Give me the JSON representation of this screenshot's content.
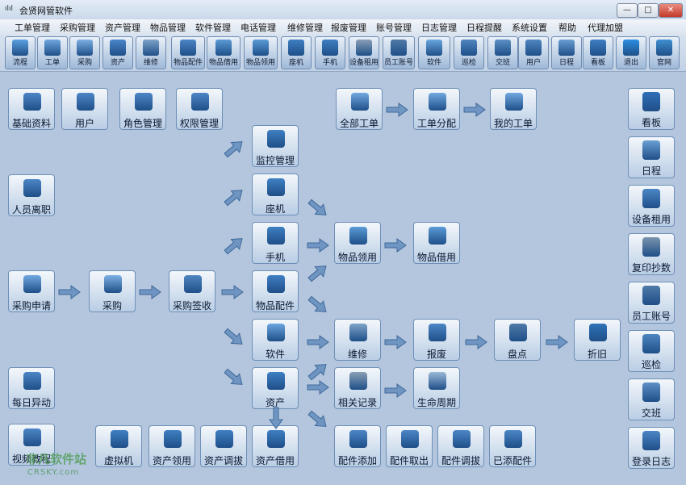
{
  "window": {
    "title": "会贤网管软件",
    "app_icon": "app-logo-icon",
    "controls": [
      "minimize-icon",
      "maximize-icon",
      "close-icon"
    ]
  },
  "menu": [
    "工单管理",
    "采购管理",
    "资产管理",
    "物品管理",
    "软件管理",
    "电话管理",
    "维修管理",
    "报废管理",
    "账号管理",
    "日志管理",
    "日程提醒",
    "系统设置",
    "帮助",
    "代理加盟"
  ],
  "toolbar": [
    {
      "label": "流程",
      "icon": "flow-icon",
      "color": "#5aa0e0"
    },
    {
      "label": "工单",
      "icon": "document-icon",
      "color": "#6fa8df"
    },
    {
      "label": "采购",
      "icon": "cart-icon",
      "color": "#7db0e2"
    },
    {
      "label": "资产",
      "icon": "monitor-icon",
      "color": "#4b86c9"
    },
    {
      "label": "维修",
      "icon": "tools-icon",
      "color": "#7ea3c9"
    },
    {
      "label": "物品配件",
      "icon": "parts-icon",
      "color": "#4c86c6"
    },
    {
      "label": "物品借用",
      "icon": "borrow-icon",
      "color": "#5a9bd6"
    },
    {
      "label": "物品领用",
      "icon": "receive-icon",
      "color": "#5a9bd6"
    },
    {
      "label": "座机",
      "icon": "phone-icon",
      "color": "#3f7fc2"
    },
    {
      "label": "手机",
      "icon": "mobile-icon",
      "color": "#3f7fc2"
    },
    {
      "label": "设备租用",
      "icon": "printer-icon",
      "color": "#8a9fb6"
    },
    {
      "label": "员工账号",
      "icon": "lock-icon",
      "color": "#4f7aa8"
    },
    {
      "label": "软件",
      "icon": "disc-icon",
      "color": "#6aa6df"
    },
    {
      "label": "巡检",
      "icon": "patrol-icon",
      "color": "#4f86c0"
    },
    {
      "label": "交班",
      "icon": "handshake-icon",
      "color": "#5c8fc6"
    },
    {
      "label": "用户",
      "icon": "user-icon",
      "color": "#4f86c0"
    },
    {
      "label": "日程",
      "icon": "calendar-icon",
      "color": "#6a9fd3"
    },
    {
      "label": "看板",
      "icon": "bell-icon",
      "color": "#3f7fc2"
    },
    {
      "label": "退出",
      "icon": "exit-icon",
      "color": "#2b8de0"
    },
    {
      "label": "官网",
      "icon": "home-icon",
      "color": "#3f8fd0"
    }
  ],
  "flow_nodes": [
    {
      "label": "基础资料",
      "icon": "settings-doc-icon",
      "color": "#4c86c6"
    },
    {
      "label": "用户",
      "icon": "user-icon",
      "color": "#4c86c6"
    },
    {
      "label": "角色管理",
      "icon": "users-icon",
      "color": "#4c86c6"
    },
    {
      "label": "权限管理",
      "icon": "user-permission-icon",
      "color": "#4c86c6"
    },
    {
      "label": "人员离职",
      "icon": "user-remove-icon",
      "color": "#4c86c6"
    },
    {
      "label": "监控管理",
      "icon": "camera-icon",
      "color": "#3f7fc2"
    },
    {
      "label": "座机",
      "icon": "phone-icon",
      "color": "#3f7fc2"
    },
    {
      "label": "手机",
      "icon": "mobile-icon",
      "color": "#3f7fc2"
    },
    {
      "label": "物品配件",
      "icon": "parts-icon",
      "color": "#3f7fc2"
    },
    {
      "label": "软件",
      "icon": "disc-icon",
      "color": "#6aa6df"
    },
    {
      "label": "资产",
      "icon": "monitor-icon",
      "color": "#3f7fc2"
    },
    {
      "label": "采购申请",
      "icon": "document-icon",
      "color": "#6fa8df"
    },
    {
      "label": "采购",
      "icon": "cart-icon",
      "color": "#7db0e2"
    },
    {
      "label": "采购签收",
      "icon": "save-icon",
      "color": "#4f86c0"
    },
    {
      "label": "物品领用",
      "icon": "receive-icon",
      "color": "#5a9bd6"
    },
    {
      "label": "物品借用",
      "icon": "borrow-icon",
      "color": "#5a9bd6"
    },
    {
      "label": "维修",
      "icon": "tools-icon",
      "color": "#7ea3c9"
    },
    {
      "label": "报废",
      "icon": "scrap-icon",
      "color": "#4c86c6"
    },
    {
      "label": "盘点",
      "icon": "tablet-icon",
      "color": "#4f7aa8"
    },
    {
      "label": "折旧",
      "icon": "yen-icon",
      "color": "#2f73b6"
    },
    {
      "label": "相关记录",
      "icon": "chain-icon",
      "color": "#8a9fb6"
    },
    {
      "label": "生命周期",
      "icon": "baby-icon",
      "color": "#9bb9d8"
    },
    {
      "label": "全部工单",
      "icon": "document-icon",
      "color": "#6fa8df"
    },
    {
      "label": "工单分配",
      "icon": "document-icon",
      "color": "#6fa8df"
    },
    {
      "label": "我的工单",
      "icon": "document-icon",
      "color": "#6fa8df"
    },
    {
      "label": "每日异动",
      "icon": "pulse-icon",
      "color": "#4c86c6"
    },
    {
      "label": "视频教程",
      "icon": "video-icon",
      "color": "#4c86c6"
    },
    {
      "label": "虚拟机",
      "icon": "monitor-icon",
      "color": "#3f7fc2"
    },
    {
      "label": "资产领用",
      "icon": "monitor-icon",
      "color": "#3f7fc2"
    },
    {
      "label": "资产调拔",
      "icon": "monitor-icon",
      "color": "#3f7fc2"
    },
    {
      "label": "资产借用",
      "icon": "monitor-icon",
      "color": "#3f7fc2"
    },
    {
      "label": "配件添加",
      "icon": "doc-add-icon",
      "color": "#4c86c6"
    },
    {
      "label": "配件取出",
      "icon": "doc-remove-icon",
      "color": "#4c86c6"
    },
    {
      "label": "配件调拔",
      "icon": "doc-transfer-icon",
      "color": "#4c86c6"
    },
    {
      "label": "已添配件",
      "icon": "tree-icon",
      "color": "#4c86c6"
    }
  ],
  "right_panel": [
    {
      "label": "看板",
      "icon": "bell-icon",
      "color": "#2f6fb8"
    },
    {
      "label": "日程",
      "icon": "calendar-icon",
      "color": "#6a9fd3"
    },
    {
      "label": "设备租用",
      "icon": "lease-icon",
      "color": "#4c86c6"
    },
    {
      "label": "复印抄数",
      "icon": "copier-icon",
      "color": "#7a93ad"
    },
    {
      "label": "员工账号",
      "icon": "lock-icon",
      "color": "#4f7aa8"
    },
    {
      "label": "巡检",
      "icon": "patrol-icon",
      "color": "#4f86c0"
    },
    {
      "label": "交班",
      "icon": "handshake-icon",
      "color": "#5c8fc6"
    },
    {
      "label": "登录日志",
      "icon": "log-icon",
      "color": "#4c86c6"
    }
  ],
  "watermark": {
    "text": "非凡软件站",
    "sub": "CRSKY.com"
  }
}
